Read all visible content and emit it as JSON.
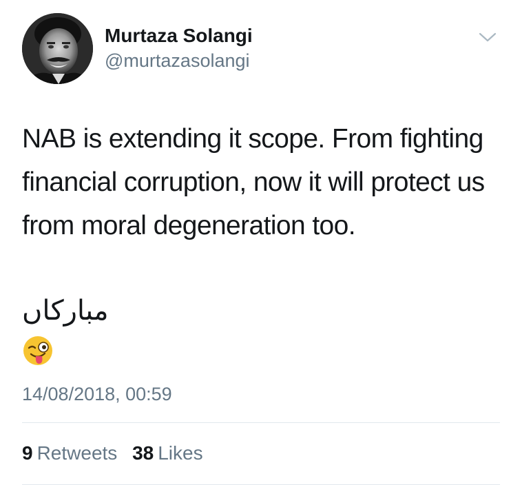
{
  "author": {
    "display_name": "Murtaza Solangi",
    "handle": "@murtazasolangi",
    "avatar_icon": "user-avatar-photo"
  },
  "menu_icon": "chevron-down-icon",
  "tweet": {
    "text": "NAB is extending it scope. From fighting financial corruption, now it will protect us from moral degeneration too.",
    "urdu_text": "مبارکاں",
    "emoji": "winking-face-with-tongue-emoji",
    "timestamp": "14/08/2018, 00:59"
  },
  "stats": {
    "retweets_count": "9",
    "retweets_label": "Retweets",
    "likes_count": "38",
    "likes_label": "Likes"
  },
  "colors": {
    "primary_text": "#14171a",
    "secondary_text": "#657786",
    "divider": "#e1e8ed",
    "emoji_face": "#f7c431",
    "emoji_tongue": "#e8496a"
  }
}
